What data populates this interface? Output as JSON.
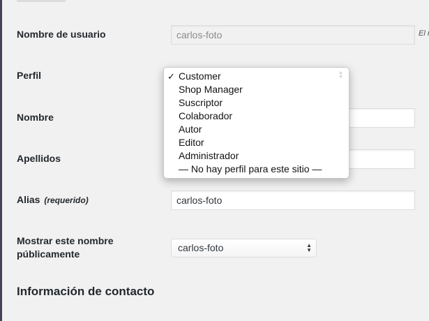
{
  "form": {
    "username_label": "Nombre de usuario",
    "username_value": "carlos-foto",
    "username_note": "El n",
    "role_label": "Perfil",
    "firstname_label": "Nombre",
    "lastname_label": "Apellidos",
    "nickname_label": "Alias",
    "nickname_required": "(requerido)",
    "nickname_value": "carlos-foto",
    "display_label_line1": "Mostrar este nombre",
    "display_label_line2": "públicamente",
    "display_selected": "carlos-foto",
    "contact_heading": "Información de contacto"
  },
  "role_dropdown": {
    "selected_mark": "✓",
    "options": [
      "Customer",
      "Shop Manager",
      "Suscriptor",
      "Colaborador",
      "Autor",
      "Editor",
      "Administrador",
      "— No hay perfil para este sitio —"
    ],
    "selected_index": 0
  },
  "icons": {
    "select_arrows": "up-down-arrows-icon",
    "check": "check-icon"
  },
  "colors": {
    "background": "#f1f1f1",
    "left_accent": "#4a3f59",
    "text": "#23282d"
  }
}
